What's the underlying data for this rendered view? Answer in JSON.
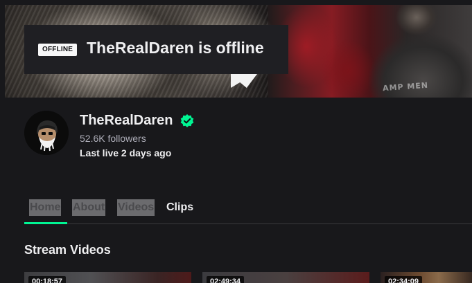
{
  "banner": {
    "offline_badge": "OFFLINE",
    "offline_title": "TheRealDaren is offline",
    "shirt_text": "AMP MEN"
  },
  "channel": {
    "name": "TheRealDaren",
    "verified": true,
    "followers": "52.6K followers",
    "last_live": "Last live 2 days ago"
  },
  "tabs": [
    {
      "label": "Home",
      "active": true
    },
    {
      "label": "About",
      "active": false
    },
    {
      "label": "Videos",
      "active": false
    },
    {
      "label": "Clips",
      "active": false
    }
  ],
  "section": {
    "title": "Stream Videos"
  },
  "videos": [
    {
      "duration": "00:18:57"
    },
    {
      "duration": "02:49:34"
    },
    {
      "duration": "02:34:09"
    }
  ],
  "colors": {
    "accent": "#00f593",
    "background": "#18181b",
    "verified": "#00f593"
  }
}
